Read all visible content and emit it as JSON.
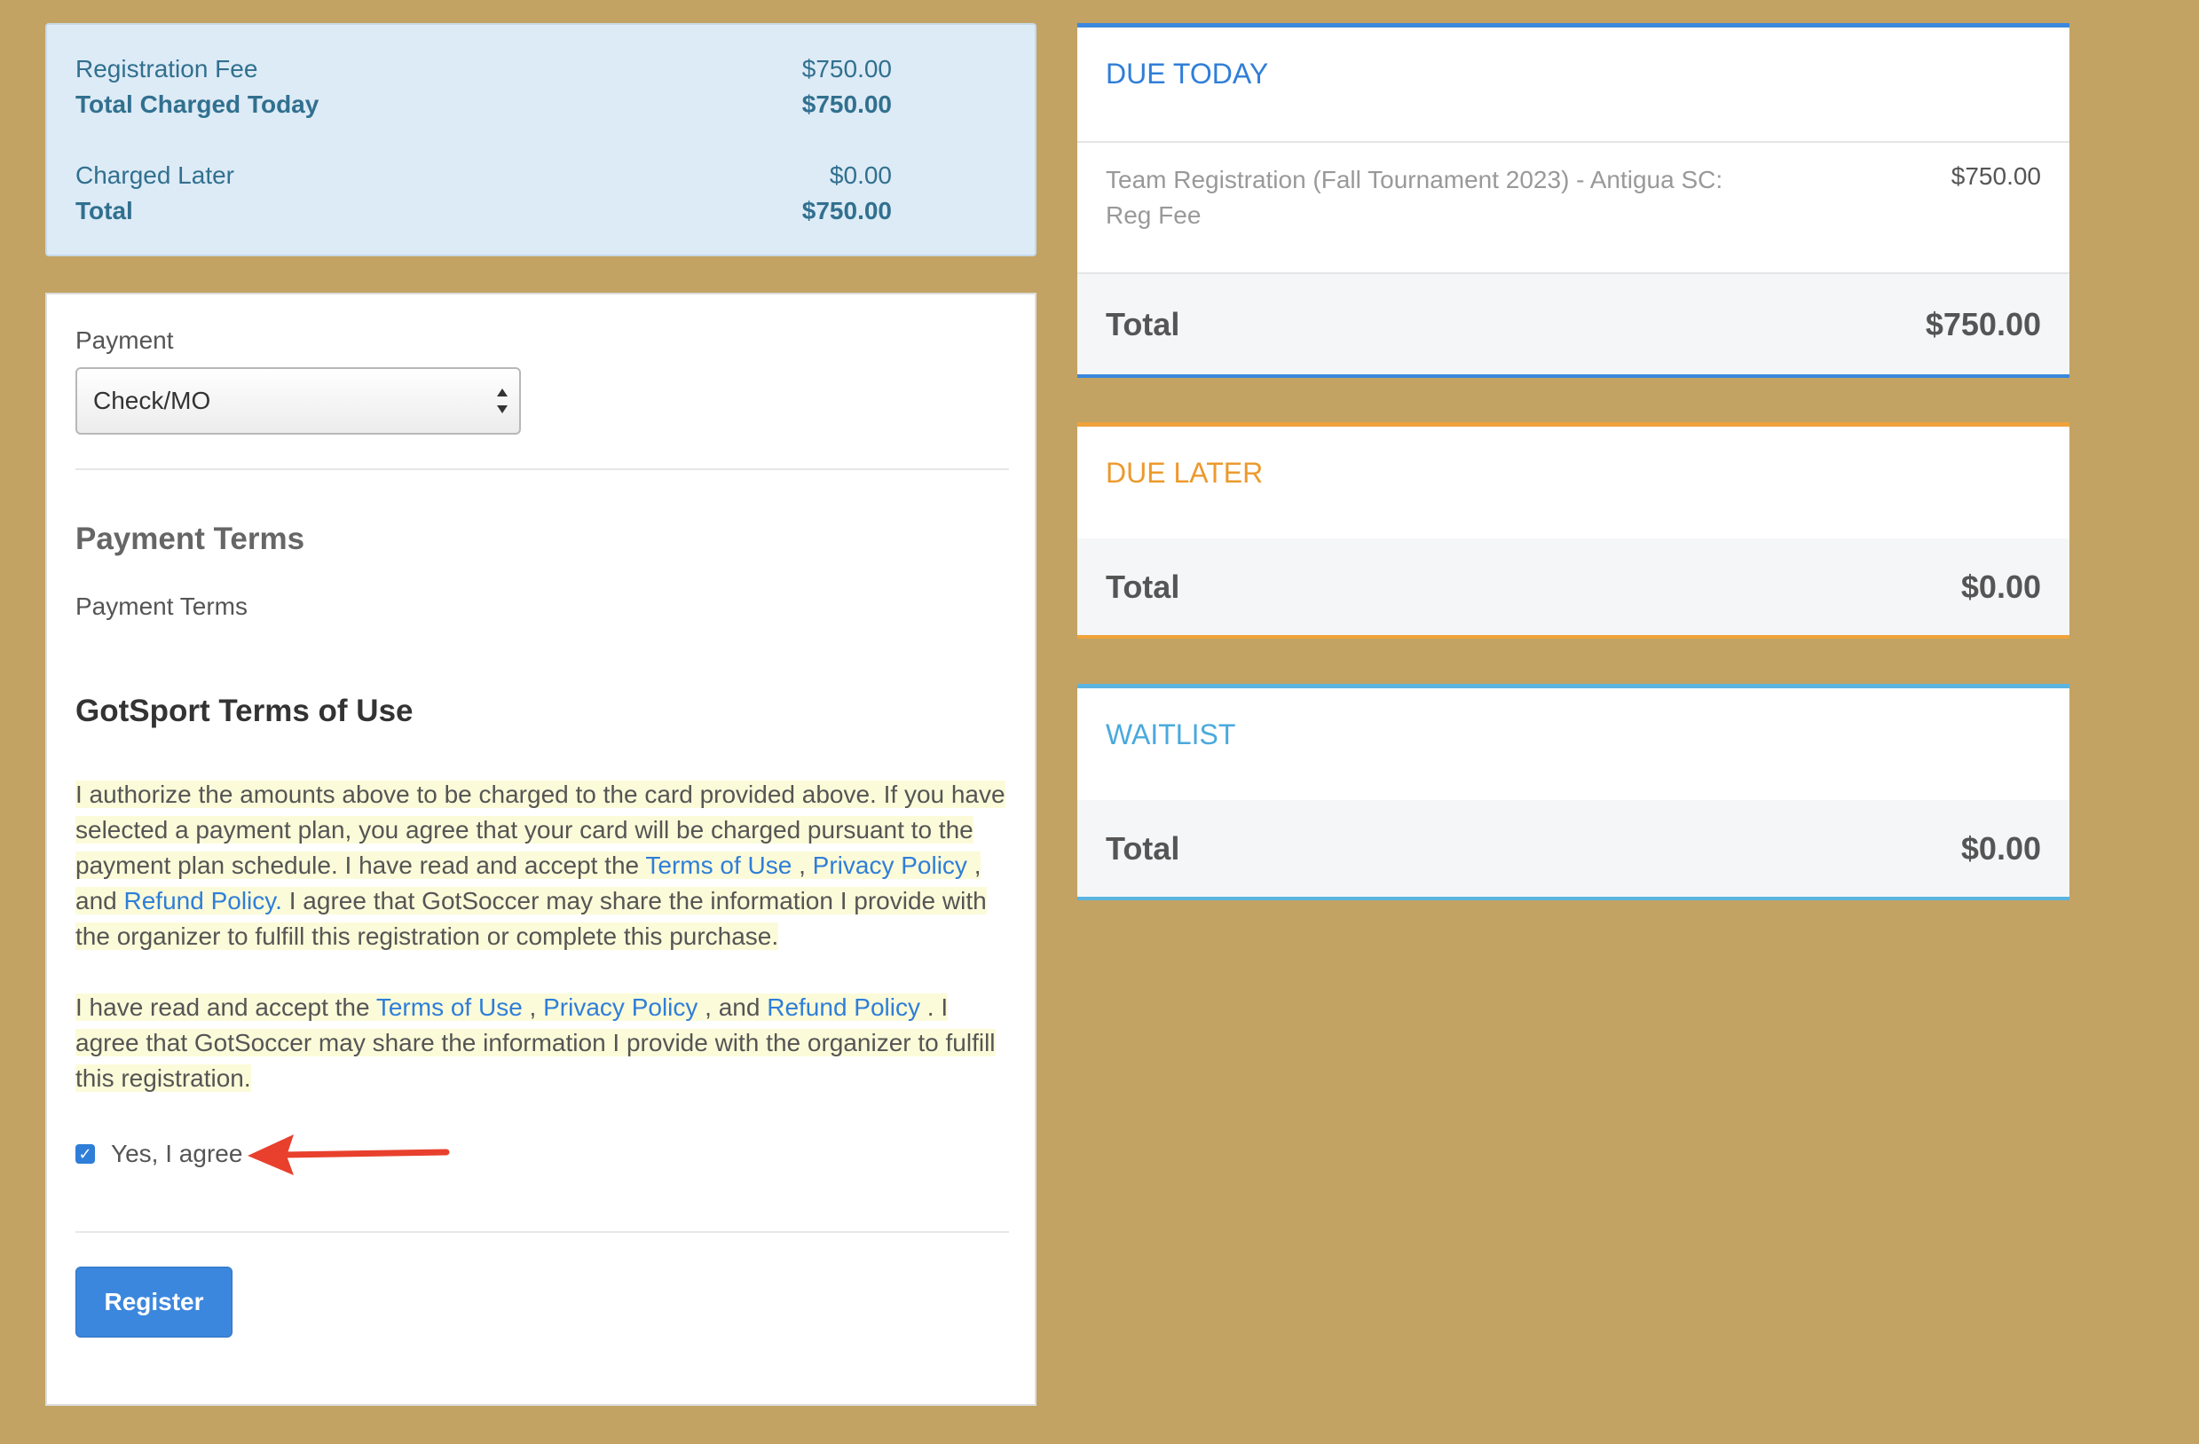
{
  "summary": {
    "registration_fee_label": "Registration Fee",
    "registration_fee_value": "$750.00",
    "total_today_label": "Total Charged Today",
    "total_today_value": "$750.00",
    "charged_later_label": "Charged Later",
    "charged_later_value": "$0.00",
    "total_label": "Total",
    "total_value": "$750.00"
  },
  "payment": {
    "label": "Payment",
    "selected": "Check/MO"
  },
  "payment_terms": {
    "heading": "Payment Terms",
    "body": "Payment Terms"
  },
  "terms_of_use": {
    "heading": "GotSport Terms of Use",
    "para1": {
      "text_a": "I authorize the amounts above to be charged to the card provided above. If you have selected a payment plan, you agree that your card will be charged pursuant to the payment plan schedule. I have read and accept the ",
      "link_terms": "Terms of Use",
      "sep1": " , ",
      "link_privacy": "Privacy Policy",
      "sep2": " , and ",
      "link_refund": "Refund Policy.",
      "text_b": " I agree that GotSoccer may share the information I provide with the organizer to fulfill this registration or complete this purchase."
    },
    "para2": {
      "text_a": "I have read and accept the ",
      "link_terms": "Terms of Use",
      "sep1": " , ",
      "link_privacy": "Privacy Policy",
      "sep2": " , and ",
      "link_refund": "Refund Policy",
      "text_b": " . I agree that GotSoccer may share the information I provide with the organizer to fulfill this registration."
    },
    "agree_label": "Yes, I agree",
    "agree_checked": true
  },
  "register_button": "Register",
  "due_today": {
    "title": "DUE TODAY",
    "item_desc": "Team Registration (Fall Tournament 2023) - Antigua SC: Reg Fee",
    "item_price": "$750.00",
    "total_label": "Total",
    "total_value": "$750.00",
    "color": "#3b87dd"
  },
  "due_later": {
    "title": "DUE LATER",
    "total_label": "Total",
    "total_value": "$0.00",
    "color": "#f0a33a"
  },
  "waitlist": {
    "title": "WAITLIST",
    "total_label": "Total",
    "total_value": "$0.00",
    "color": "#5bb4e0"
  },
  "icons": {
    "checkbox": "check-icon",
    "annotation": "red-arrow-icon",
    "select": "select-arrows-icon"
  }
}
